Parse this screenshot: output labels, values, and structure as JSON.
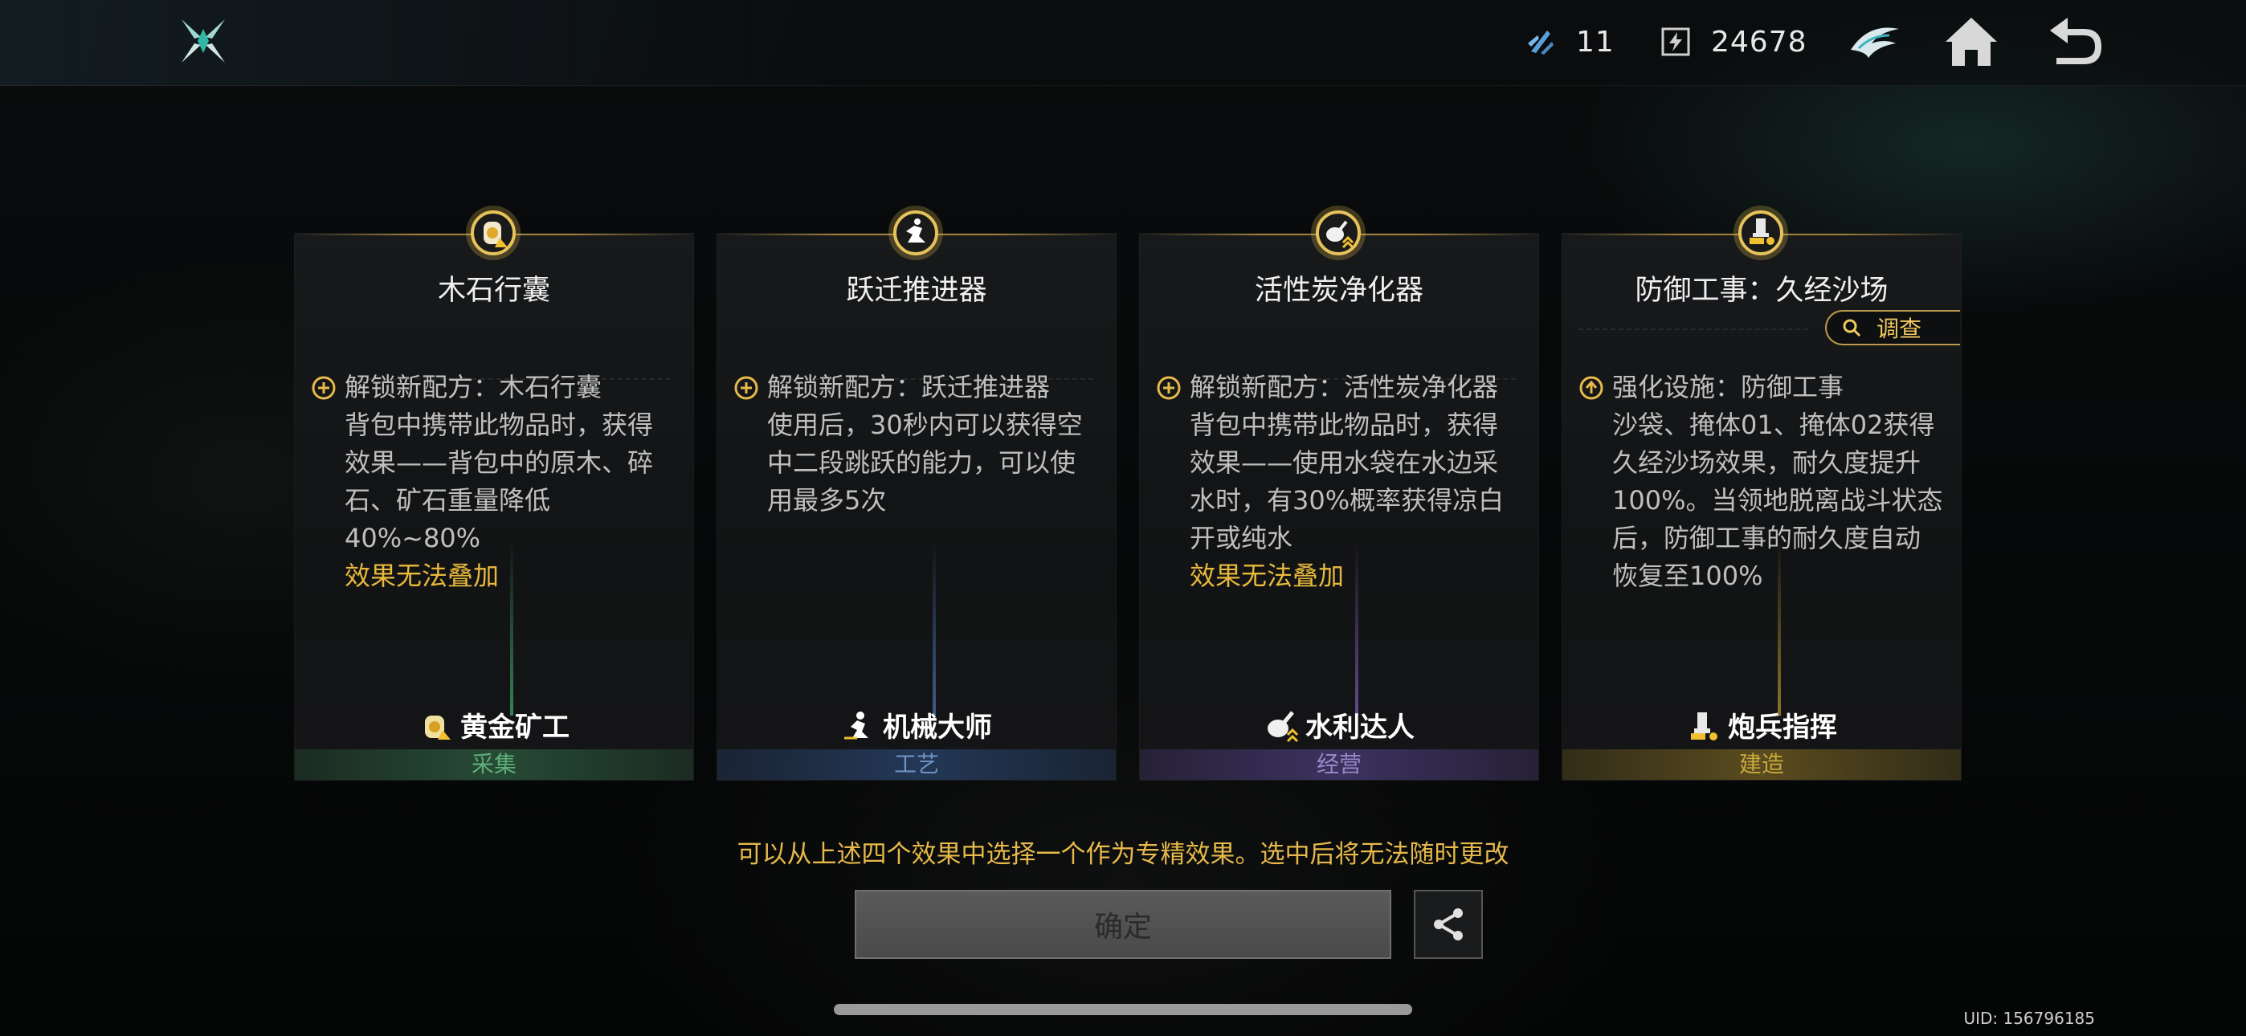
{
  "topbar": {
    "resources": [
      {
        "icon": "crystal-shard-icon",
        "value": "11"
      },
      {
        "icon": "energy-chip-icon",
        "value": "24678"
      }
    ],
    "nav": [
      "emblem-icon",
      "home-icon",
      "back-arrow-icon"
    ]
  },
  "cards": [
    {
      "title": "木石行囊",
      "unlock": "解锁新配方：木石行囊",
      "body": "背包中携带此物品时，获得效果——背包中的原木、碎石、矿石重量降低40%~80%",
      "warn": "效果无法叠加",
      "profession": "黄金矿工",
      "category": "采集",
      "accent": "#3f8f5c"
    },
    {
      "title": "跃迁推进器",
      "unlock": "解锁新配方：跃迁推进器",
      "body": "使用后，30秒内可以获得空中二段跳跃的能力，可以使用最多5次",
      "warn": "",
      "profession": "机械大师",
      "category": "工艺",
      "accent": "#4a6fa0"
    },
    {
      "title": "活性炭净化器",
      "unlock": "解锁新配方：活性炭净化器",
      "body": "背包中携带此物品时，获得效果——使用水袋在水边采水时，有30%概率获得凉白开或纯水",
      "warn": "效果无法叠加",
      "profession": "水利达人",
      "category": "经营",
      "accent": "#7a5ab0"
    },
    {
      "title": "防御工事：久经沙场",
      "unlock": "强化设施：防御工事",
      "body": "沙袋、掩体01、掩体02获得久经沙场效果，耐久度提升100%。当领地脱离战斗状态后，防御工事的耐久度自动恢复至100%",
      "warn": "",
      "profession": "炮兵指挥",
      "category": "建造",
      "accent": "#b0922e",
      "investigate": "调查"
    }
  ],
  "hint": "可以从上述四个效果中选择一个作为专精效果。选中后将无法随时更改",
  "confirm_label": "确定",
  "uid": "UID: 156796185"
}
